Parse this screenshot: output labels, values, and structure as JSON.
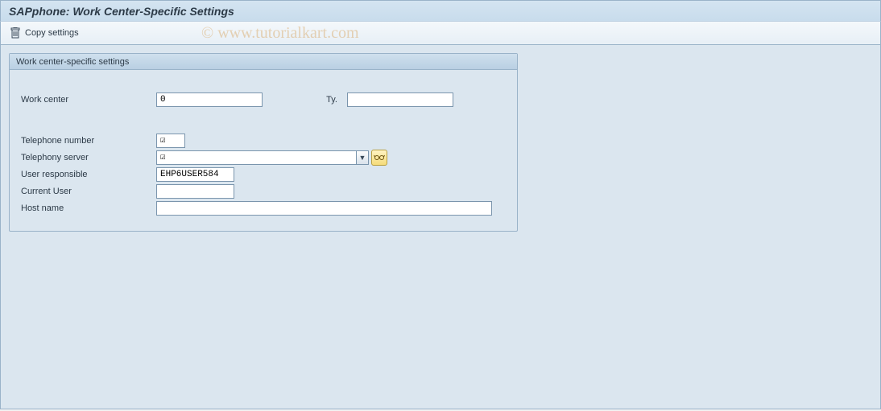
{
  "header": {
    "title": "SAPphone: Work Center-Specific Settings"
  },
  "toolbar": {
    "copy_settings_label": "Copy settings"
  },
  "groupbox": {
    "title": "Work center-specific settings",
    "labels": {
      "work_center": "Work center",
      "ty": "Ty.",
      "telephone_number": "Telephone number",
      "telephony_server": "Telephony server",
      "user_responsible": "User responsible",
      "current_user": "Current User",
      "host_name": "Host name"
    },
    "values": {
      "work_center": "0",
      "ty": "",
      "telephone_number": "☑",
      "telephony_server": "☑",
      "user_responsible": "EHP6USER584",
      "current_user": "",
      "host_name": ""
    }
  },
  "watermark": "© www.tutorialkart.com"
}
